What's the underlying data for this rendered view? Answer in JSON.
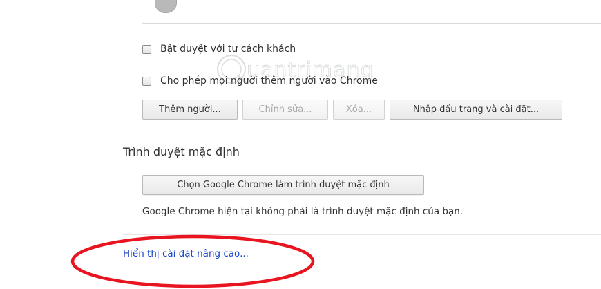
{
  "guest_option": {
    "label": "Bật duyệt với tư cách khách",
    "checked": false
  },
  "add_people_option": {
    "label": "Cho phép mọi người thêm người vào Chrome",
    "checked": false
  },
  "people_buttons": {
    "add": "Thêm người...",
    "edit": "Chỉnh sửa...",
    "delete": "Xóa...",
    "import": "Nhập dấu trang và cài đặt..."
  },
  "default_browser": {
    "title": "Trình duyệt mặc định",
    "make_default_button": "Chọn Google Chrome làm trình duyệt mặc định",
    "status": "Google Chrome hiện tại không phải là trình duyệt mặc định của bạn."
  },
  "advanced_link": "Hiển thị cài đặt nâng cao...",
  "watermark": {
    "text": "uantrimang"
  },
  "colors": {
    "link": "#1a46c8",
    "annotation": "#e8141f",
    "text": "#303030",
    "disabled_text": "#a7a7a7"
  }
}
